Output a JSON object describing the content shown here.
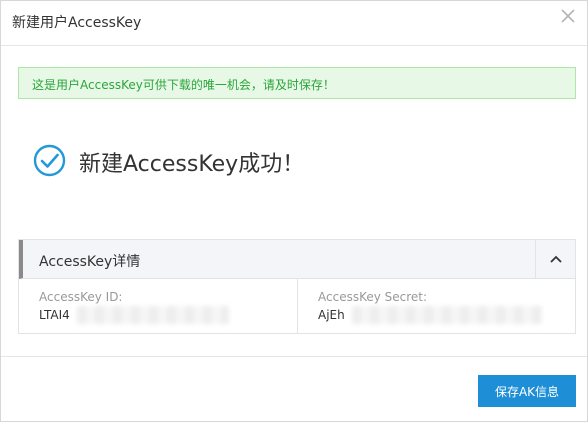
{
  "dialog": {
    "title": "新建用户AccessKey",
    "close_icon": "close-icon"
  },
  "notice": {
    "text": "这是用户AccessKey可供下载的唯一机会，请及时保存！",
    "bg_color": "#e8f8e6",
    "text_color": "#2aa53b"
  },
  "success": {
    "icon": "check-circle-icon",
    "message": "新建AccessKey成功！",
    "icon_color": "#2399d8"
  },
  "details": {
    "title": "AccessKey详情",
    "toggle_icon": "chevron-up-icon",
    "id_label": "AccessKey ID:",
    "id_value": "LTAI4",
    "secret_label": "AccessKey Secret:",
    "secret_value": "AjEh"
  },
  "footer": {
    "save_label": "保存AK信息",
    "button_color": "#1e8fd6"
  }
}
